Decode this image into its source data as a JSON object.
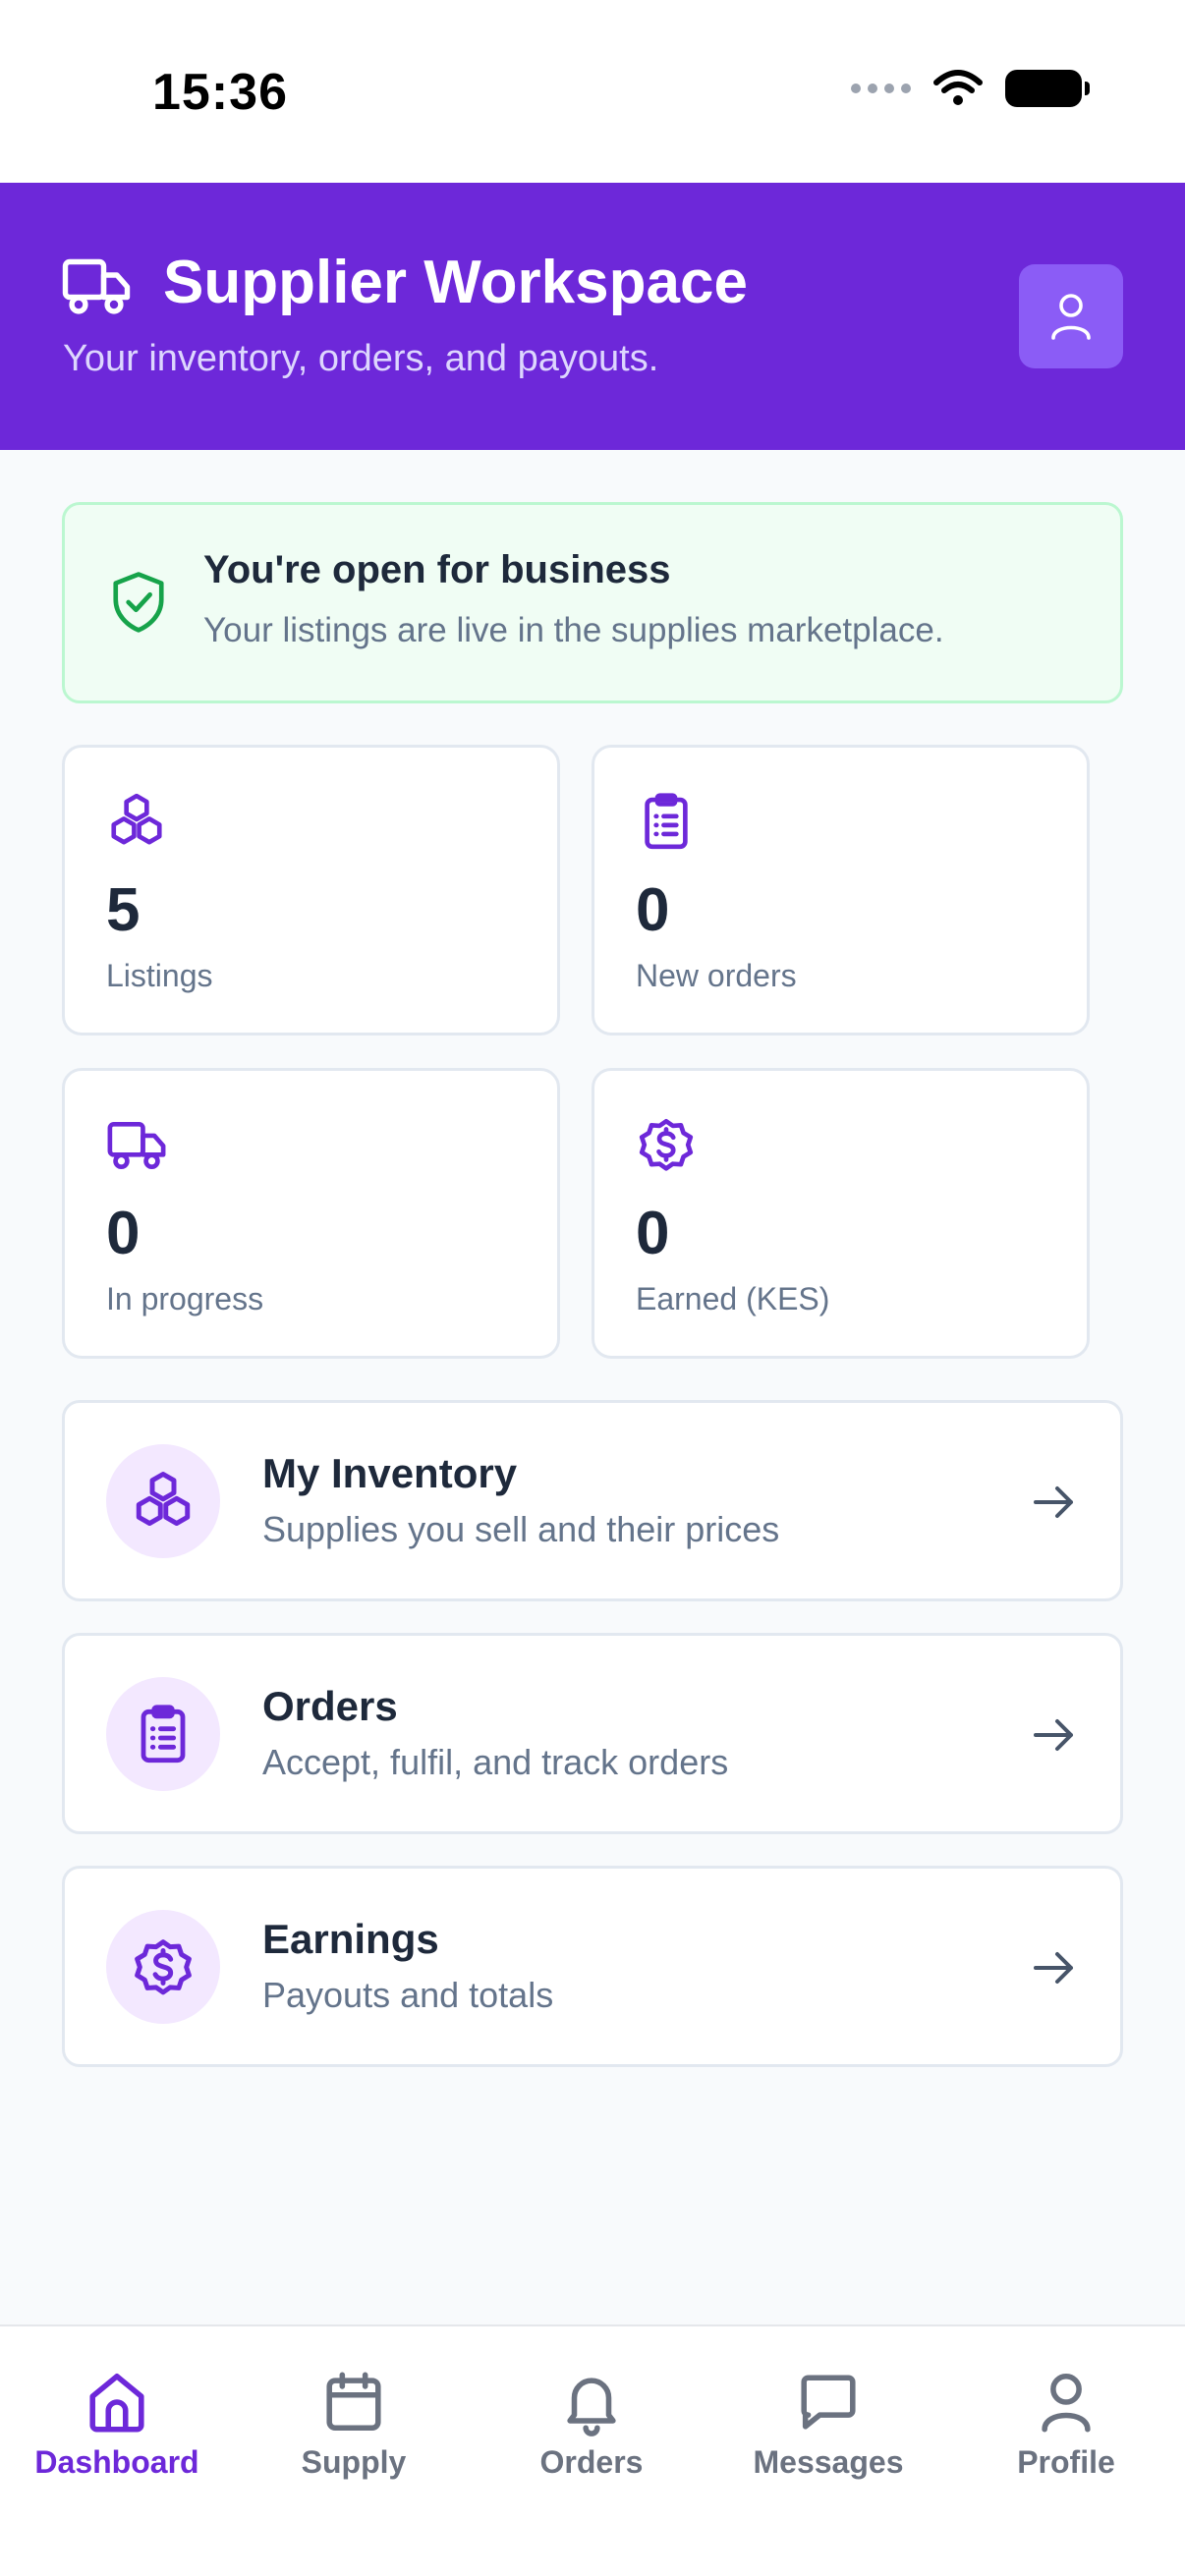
{
  "status_bar": {
    "time": "15:36"
  },
  "header": {
    "title": "Supplier Workspace",
    "subtitle": "Your inventory, orders, and payouts.",
    "bg_color": "#6d28d9"
  },
  "banner": {
    "title": "You're open for business",
    "text": "Your listings are live in the supplies marketplace.",
    "icon": "shield-check-icon"
  },
  "stats": [
    {
      "value": "5",
      "label": "Listings",
      "icon": "cubes-icon"
    },
    {
      "value": "0",
      "label": "New orders",
      "icon": "clipboard-icon"
    },
    {
      "value": "0",
      "label": "In progress",
      "icon": "truck-icon"
    },
    {
      "value": "0",
      "label": "Earned (KES)",
      "icon": "dollar-badge-icon"
    }
  ],
  "rows": [
    {
      "title": "My Inventory",
      "subtitle": "Supplies you sell and their prices",
      "icon": "cubes-icon"
    },
    {
      "title": "Orders",
      "subtitle": "Accept, fulfil, and track orders",
      "icon": "clipboard-icon"
    },
    {
      "title": "Earnings",
      "subtitle": "Payouts and totals",
      "icon": "dollar-badge-icon"
    }
  ],
  "tabs": [
    {
      "label": "Dashboard",
      "icon": "home-icon",
      "active": true
    },
    {
      "label": "Supply",
      "icon": "calendar-icon",
      "active": false
    },
    {
      "label": "Orders",
      "icon": "bell-icon",
      "active": false
    },
    {
      "label": "Messages",
      "icon": "message-icon",
      "active": false
    },
    {
      "label": "Profile",
      "icon": "user-icon",
      "active": false
    }
  ],
  "colors": {
    "accent": "#6d28d9",
    "success": "#16a34a",
    "muted_text": "#64748b"
  }
}
